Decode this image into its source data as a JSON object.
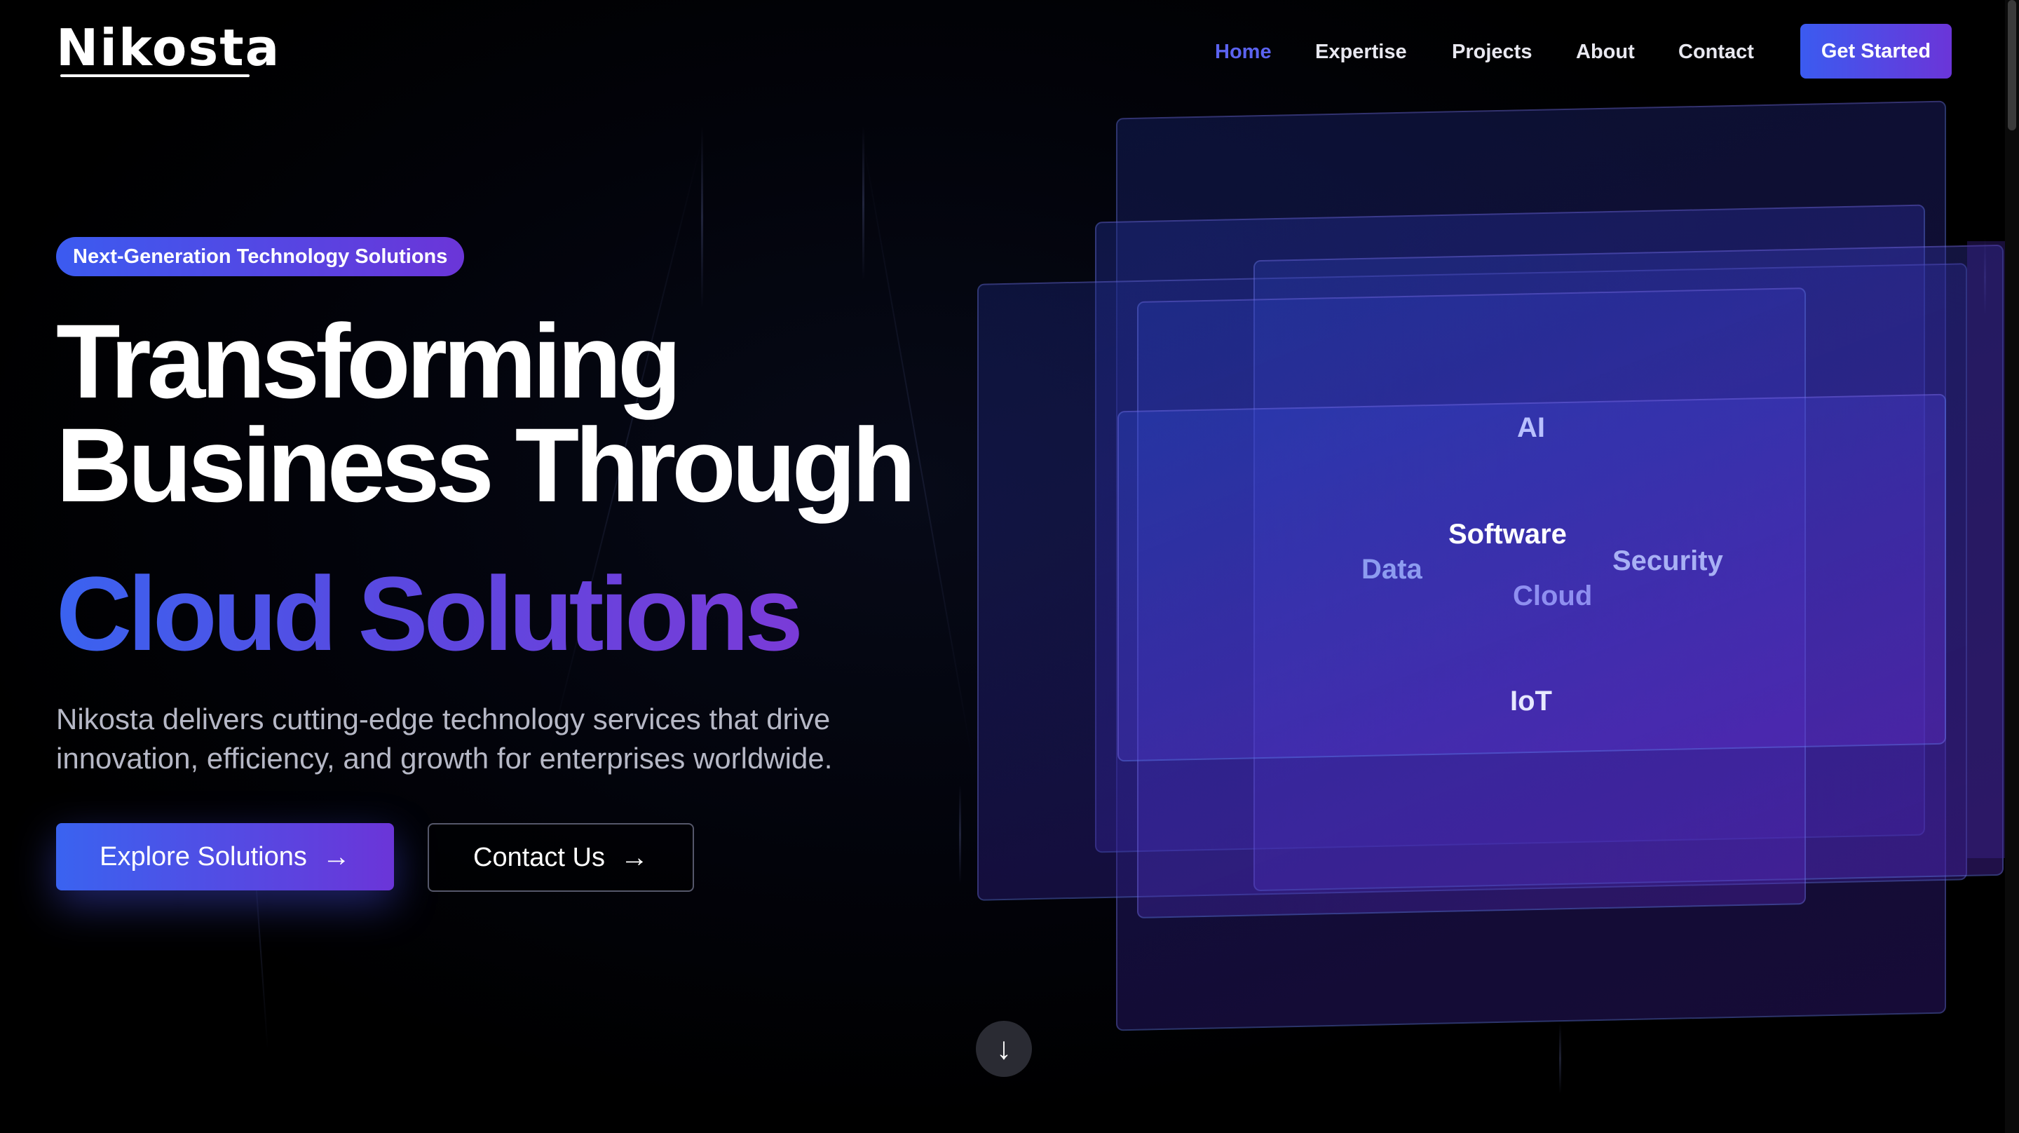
{
  "header": {
    "logo": "Nikosta",
    "nav": [
      {
        "label": "Home",
        "active": true
      },
      {
        "label": "Expertise",
        "active": false
      },
      {
        "label": "Projects",
        "active": false
      },
      {
        "label": "About",
        "active": false
      },
      {
        "label": "Contact",
        "active": false
      }
    ],
    "cta_label": "Get Started"
  },
  "hero": {
    "badge": "Next-Generation Technology Solutions",
    "title_line1": "Transforming",
    "title_line2": "Business Through",
    "title_highlight": "Cloud Solutions",
    "description": "Nikosta delivers cutting-edge technology services that drive innovation, efficiency, and growth for enterprises worldwide.",
    "primary_button": "Explore Solutions",
    "secondary_button": "Contact Us"
  },
  "visual": {
    "tags": [
      "AI",
      "Software",
      "Data",
      "Security",
      "Cloud",
      "IoT"
    ]
  },
  "icons": {
    "button_arrow": "arrow-right-icon",
    "scroll": "arrow-down-icon"
  },
  "colors": {
    "accent": "#5b63f0",
    "gradient_start": "#3b5bf0",
    "gradient_end": "#6b35d8",
    "background": "#000000"
  }
}
